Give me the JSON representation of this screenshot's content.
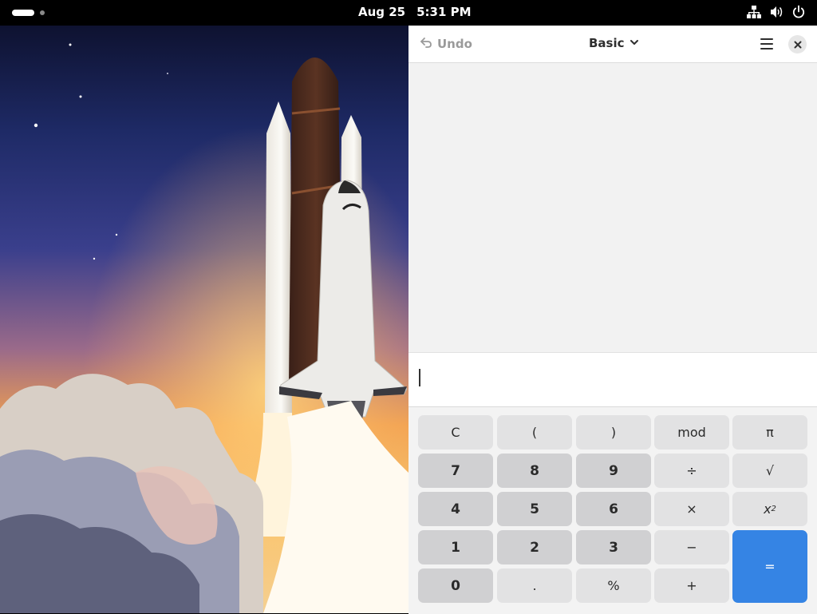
{
  "topbar": {
    "date": "Aug 25",
    "time": "5:31 PM",
    "icons": [
      "network-icon",
      "volume-icon",
      "power-icon"
    ]
  },
  "calculator": {
    "undo_label": "Undo",
    "mode_label": "Basic",
    "entry_value": "",
    "accent_color": "#3584e4",
    "keys": {
      "clear": "C",
      "open_paren": "(",
      "close_paren": ")",
      "mod": "mod",
      "pi": "π",
      "seven": "7",
      "eight": "8",
      "nine": "9",
      "divide": "÷",
      "sqrt": "√",
      "four": "4",
      "five": "5",
      "six": "6",
      "multiply": "×",
      "square_base": "x",
      "square_exp": "2",
      "one": "1",
      "two": "2",
      "three": "3",
      "minus": "−",
      "equals": "=",
      "zero": "0",
      "point": ".",
      "percent": "%",
      "plus": "+"
    }
  }
}
